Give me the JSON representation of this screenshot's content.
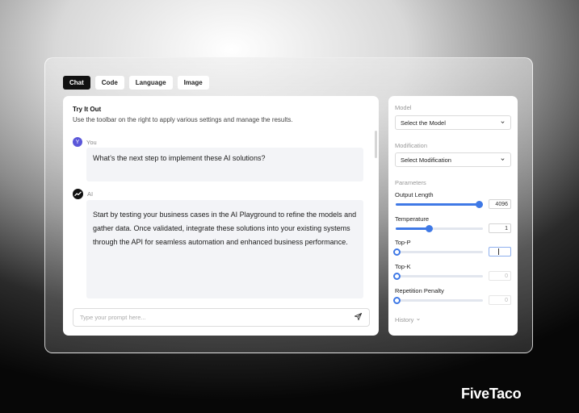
{
  "tabs": [
    {
      "label": "Chat",
      "active": true
    },
    {
      "label": "Code",
      "active": false
    },
    {
      "label": "Language",
      "active": false
    },
    {
      "label": "Image",
      "active": false
    }
  ],
  "chat": {
    "title": "Try It Out",
    "subtitle": "Use the toolbar on the right to apply various settings and manage the results.",
    "messages": [
      {
        "role": "You",
        "avatar": "Y",
        "text": "What’s the next step to implement these AI solutions?"
      },
      {
        "role": "AI",
        "avatar_icon": "trend-icon",
        "text": "Start by testing your business cases in the AI Playground to refine the models and gather data. Once validated, integrate these solutions into your existing systems through the API for seamless automation and enhanced business performance."
      }
    ],
    "prompt_placeholder": "Type your prompt here..."
  },
  "settings": {
    "model_label": "Model",
    "model_select": "Select the Model",
    "modification_label": "Modification",
    "modification_select": "Select Modification",
    "parameters_label": "Parameters",
    "params": [
      {
        "label": "Output Length",
        "value": "4096",
        "level": 0.95
      },
      {
        "label": "Temperature",
        "value": "1",
        "level": 0.38
      },
      {
        "label": "Top-P",
        "value": "",
        "level": 0.0
      },
      {
        "label": "Top-K",
        "value": "0",
        "level": 0.0
      },
      {
        "label": "Repetition Penalty",
        "value": "0",
        "level": 0.0
      }
    ],
    "history_label": "History"
  },
  "brand": "FiveTaco",
  "colors": {
    "accent": "#3f79e6",
    "you_avatar": "#5b57d9"
  }
}
